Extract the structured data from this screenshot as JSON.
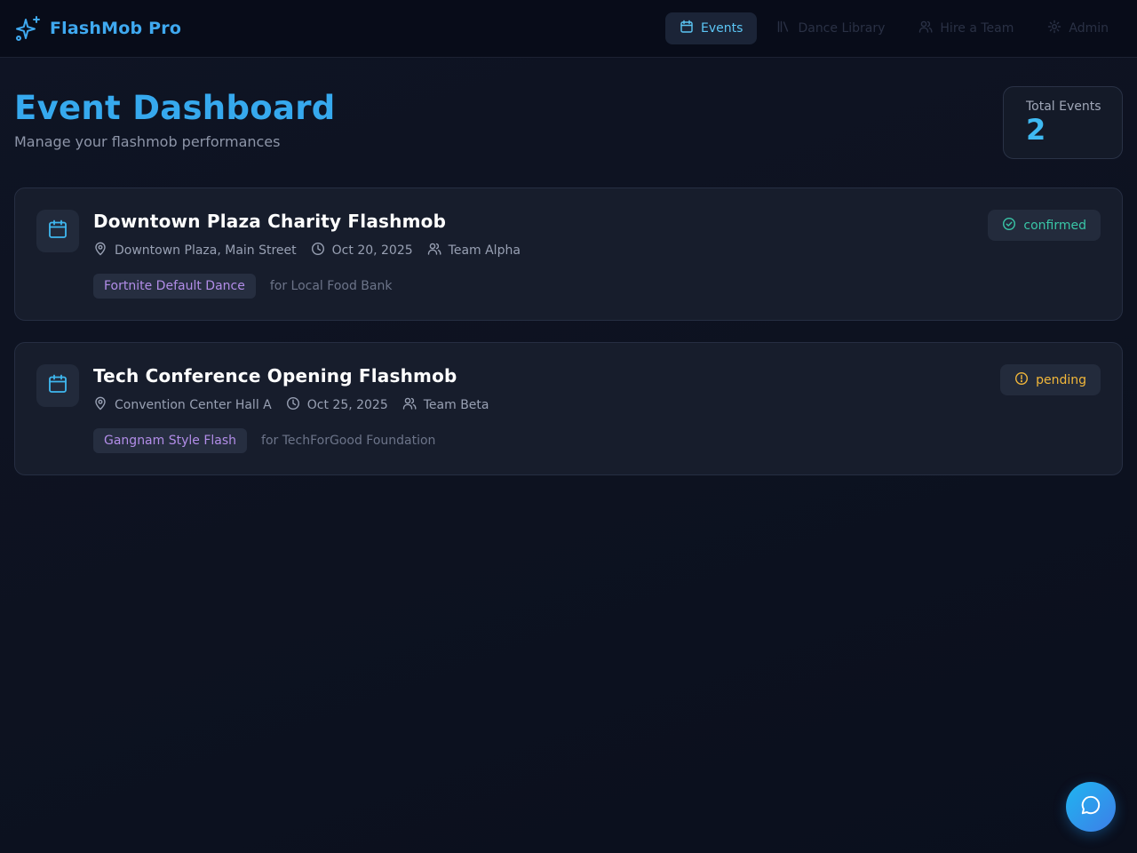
{
  "app": {
    "name": "FlashMob Pro",
    "accent": "#36a9ee",
    "brand_icon": "sparkles-icon"
  },
  "nav": {
    "items": [
      {
        "label": "Events",
        "icon": "calendar-icon",
        "active": true
      },
      {
        "label": "Dance Library",
        "icon": "library-icon",
        "active": false
      },
      {
        "label": "Hire a Team",
        "icon": "users-icon",
        "active": false
      },
      {
        "label": "Admin",
        "icon": "gear-icon",
        "active": false
      }
    ]
  },
  "page": {
    "title": "Event Dashboard",
    "subtitle": "Manage your flashmob performances"
  },
  "stats": {
    "label": "Total Events",
    "value": "2"
  },
  "events": [
    {
      "title": "Downtown Plaza Charity Flashmob",
      "location": "Downtown Plaza, Main Street",
      "date": "Oct 20, 2025",
      "team": "Team Alpha",
      "dance": "Fortnite Default Dance",
      "charity": "for Local Food Bank",
      "status": "confirmed",
      "status_color": "#39c6a7"
    },
    {
      "title": "Tech Conference Opening Flashmob",
      "location": "Convention Center Hall A",
      "date": "Oct 25, 2025",
      "team": "Team Beta",
      "dance": "Gangnam Style Flash",
      "charity": "for TechForGood Foundation",
      "status": "pending",
      "status_color": "#f2b73a"
    }
  ],
  "chat": {
    "icon": "chat-bubble-icon",
    "color": "#1fb5f0"
  }
}
